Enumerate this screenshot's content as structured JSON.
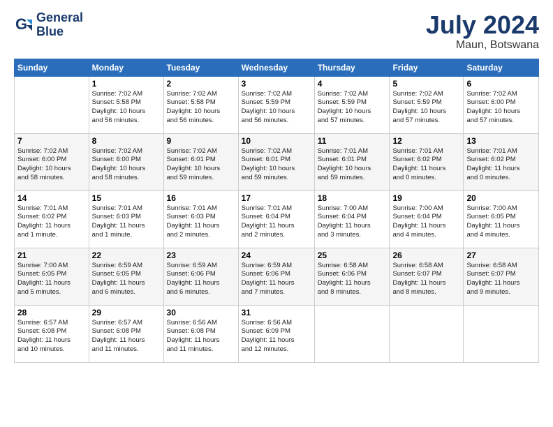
{
  "logo": {
    "line1": "General",
    "line2": "Blue"
  },
  "title": "July 2024",
  "location": "Maun, Botswana",
  "weekdays": [
    "Sunday",
    "Monday",
    "Tuesday",
    "Wednesday",
    "Thursday",
    "Friday",
    "Saturday"
  ],
  "weeks": [
    [
      {
        "day": "",
        "info": ""
      },
      {
        "day": "1",
        "info": "Sunrise: 7:02 AM\nSunset: 5:58 PM\nDaylight: 10 hours\nand 56 minutes."
      },
      {
        "day": "2",
        "info": "Sunrise: 7:02 AM\nSunset: 5:58 PM\nDaylight: 10 hours\nand 56 minutes."
      },
      {
        "day": "3",
        "info": "Sunrise: 7:02 AM\nSunset: 5:59 PM\nDaylight: 10 hours\nand 56 minutes."
      },
      {
        "day": "4",
        "info": "Sunrise: 7:02 AM\nSunset: 5:59 PM\nDaylight: 10 hours\nand 57 minutes."
      },
      {
        "day": "5",
        "info": "Sunrise: 7:02 AM\nSunset: 5:59 PM\nDaylight: 10 hours\nand 57 minutes."
      },
      {
        "day": "6",
        "info": "Sunrise: 7:02 AM\nSunset: 6:00 PM\nDaylight: 10 hours\nand 57 minutes."
      }
    ],
    [
      {
        "day": "7",
        "info": "Sunrise: 7:02 AM\nSunset: 6:00 PM\nDaylight: 10 hours\nand 58 minutes."
      },
      {
        "day": "8",
        "info": "Sunrise: 7:02 AM\nSunset: 6:00 PM\nDaylight: 10 hours\nand 58 minutes."
      },
      {
        "day": "9",
        "info": "Sunrise: 7:02 AM\nSunset: 6:01 PM\nDaylight: 10 hours\nand 59 minutes."
      },
      {
        "day": "10",
        "info": "Sunrise: 7:02 AM\nSunset: 6:01 PM\nDaylight: 10 hours\nand 59 minutes."
      },
      {
        "day": "11",
        "info": "Sunrise: 7:01 AM\nSunset: 6:01 PM\nDaylight: 10 hours\nand 59 minutes."
      },
      {
        "day": "12",
        "info": "Sunrise: 7:01 AM\nSunset: 6:02 PM\nDaylight: 11 hours\nand 0 minutes."
      },
      {
        "day": "13",
        "info": "Sunrise: 7:01 AM\nSunset: 6:02 PM\nDaylight: 11 hours\nand 0 minutes."
      }
    ],
    [
      {
        "day": "14",
        "info": "Sunrise: 7:01 AM\nSunset: 6:02 PM\nDaylight: 11 hours\nand 1 minute."
      },
      {
        "day": "15",
        "info": "Sunrise: 7:01 AM\nSunset: 6:03 PM\nDaylight: 11 hours\nand 1 minute."
      },
      {
        "day": "16",
        "info": "Sunrise: 7:01 AM\nSunset: 6:03 PM\nDaylight: 11 hours\nand 2 minutes."
      },
      {
        "day": "17",
        "info": "Sunrise: 7:01 AM\nSunset: 6:04 PM\nDaylight: 11 hours\nand 2 minutes."
      },
      {
        "day": "18",
        "info": "Sunrise: 7:00 AM\nSunset: 6:04 PM\nDaylight: 11 hours\nand 3 minutes."
      },
      {
        "day": "19",
        "info": "Sunrise: 7:00 AM\nSunset: 6:04 PM\nDaylight: 11 hours\nand 4 minutes."
      },
      {
        "day": "20",
        "info": "Sunrise: 7:00 AM\nSunset: 6:05 PM\nDaylight: 11 hours\nand 4 minutes."
      }
    ],
    [
      {
        "day": "21",
        "info": "Sunrise: 7:00 AM\nSunset: 6:05 PM\nDaylight: 11 hours\nand 5 minutes."
      },
      {
        "day": "22",
        "info": "Sunrise: 6:59 AM\nSunset: 6:05 PM\nDaylight: 11 hours\nand 6 minutes."
      },
      {
        "day": "23",
        "info": "Sunrise: 6:59 AM\nSunset: 6:06 PM\nDaylight: 11 hours\nand 6 minutes."
      },
      {
        "day": "24",
        "info": "Sunrise: 6:59 AM\nSunset: 6:06 PM\nDaylight: 11 hours\nand 7 minutes."
      },
      {
        "day": "25",
        "info": "Sunrise: 6:58 AM\nSunset: 6:06 PM\nDaylight: 11 hours\nand 8 minutes."
      },
      {
        "day": "26",
        "info": "Sunrise: 6:58 AM\nSunset: 6:07 PM\nDaylight: 11 hours\nand 8 minutes."
      },
      {
        "day": "27",
        "info": "Sunrise: 6:58 AM\nSunset: 6:07 PM\nDaylight: 11 hours\nand 9 minutes."
      }
    ],
    [
      {
        "day": "28",
        "info": "Sunrise: 6:57 AM\nSunset: 6:08 PM\nDaylight: 11 hours\nand 10 minutes."
      },
      {
        "day": "29",
        "info": "Sunrise: 6:57 AM\nSunset: 6:08 PM\nDaylight: 11 hours\nand 11 minutes."
      },
      {
        "day": "30",
        "info": "Sunrise: 6:56 AM\nSunset: 6:08 PM\nDaylight: 11 hours\nand 11 minutes."
      },
      {
        "day": "31",
        "info": "Sunrise: 6:56 AM\nSunset: 6:09 PM\nDaylight: 11 hours\nand 12 minutes."
      },
      {
        "day": "",
        "info": ""
      },
      {
        "day": "",
        "info": ""
      },
      {
        "day": "",
        "info": ""
      }
    ]
  ]
}
